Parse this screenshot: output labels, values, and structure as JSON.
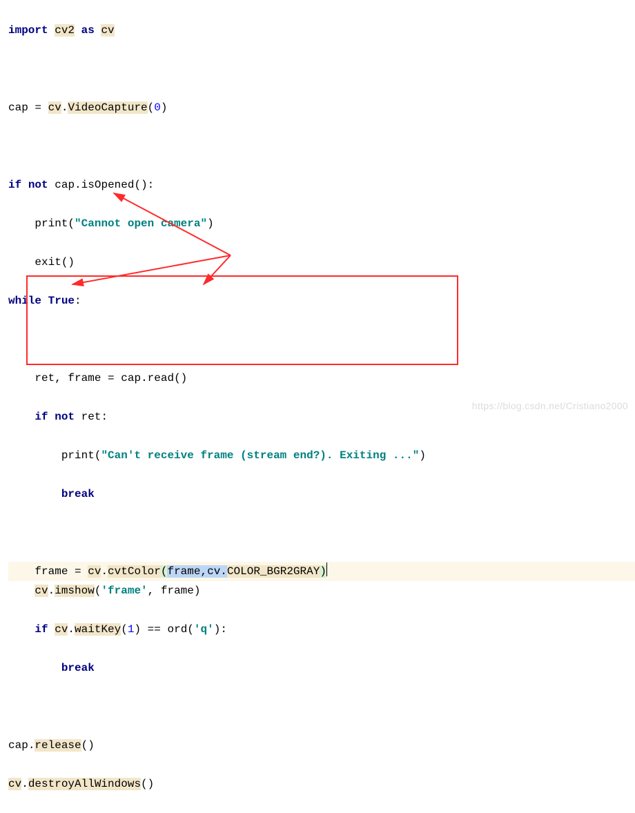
{
  "watermark": "https://blog.csdn.net/Cristiano2000",
  "code": {
    "l1": {
      "k_import": "import",
      "cv2": "cv2",
      "k_as": "as",
      "cv": "cv"
    },
    "l2": "",
    "l3": {
      "cap": "cap",
      "eq": " = ",
      "cv": "cv",
      "dot": ".",
      "vc": "VideoCapture",
      "lp": "(",
      "zero": "0",
      "rp": ")"
    },
    "l4": "",
    "l5": {
      "k_if": "if",
      "sp": " ",
      "k_not": "not",
      "sp2": " ",
      "cap": "cap",
      "dot": ".",
      "iso": "isOpened",
      "paren": "():"
    },
    "l6": {
      "indent": "    ",
      "pr": "print",
      "lp": "(",
      "s": "\"Cannot open camera\"",
      "rp": ")"
    },
    "l7": {
      "indent": "    ",
      "ex": "exit",
      "paren": "()"
    },
    "l8": {
      "k_while": "while",
      "sp": " ",
      "k_true": "True",
      "colon": ":"
    },
    "l9": "",
    "l10": {
      "indent": "    ",
      "ret": "ret",
      "comma": ", ",
      "frame": "frame",
      "eq": " = ",
      "cap": "cap",
      "dot": ".",
      "read": "read",
      "paren": "()"
    },
    "l11": {
      "indent": "    ",
      "k_if": "if",
      "sp": " ",
      "k_not": "not",
      "sp2": " ",
      "ret": "ret",
      "colon": ":"
    },
    "l12": {
      "indent": "        ",
      "pr": "print",
      "lp": "(",
      "s": "\"Can't receive frame (stream end?). Exiting ...\"",
      "rp": ")"
    },
    "l13": {
      "indent": "        ",
      "k_break": "break"
    },
    "l14": "",
    "l15": {
      "indent": "    ",
      "frame": "frame",
      "eq": " = ",
      "cv": "cv",
      "dot": ".",
      "cvt": "cvtColor",
      "lp": "(",
      "frame2": "frame",
      "comma": ",",
      "cv2": "cv",
      "dot2": ".",
      "col": "COLOR_BGR2GRAY",
      "rp": ")"
    },
    "l16": {
      "indent": "    ",
      "cv": "cv",
      "dot": ".",
      "im": "imshow",
      "lp": "(",
      "s": "'frame'",
      "comma": ", ",
      "frame": "frame",
      "rp": ")"
    },
    "l17": {
      "indent": "    ",
      "k_if": "if",
      "sp": " ",
      "cv": "cv",
      "dot": ".",
      "wk": "waitKey",
      "lp": "(",
      "one": "1",
      "rp": ")",
      "eqeq": " == ",
      "ord": "ord",
      "lp2": "(",
      "s": "'q'",
      "rp2": "):"
    },
    "l18": {
      "indent": "        ",
      "k_break": "break"
    },
    "l19": "",
    "l20": {
      "cap": "cap",
      "dot": ".",
      "rel": "release",
      "paren": "()"
    },
    "l21": {
      "cv": "cv",
      "dot": ".",
      "daw": "destroyAllWindows",
      "paren": "()"
    }
  }
}
